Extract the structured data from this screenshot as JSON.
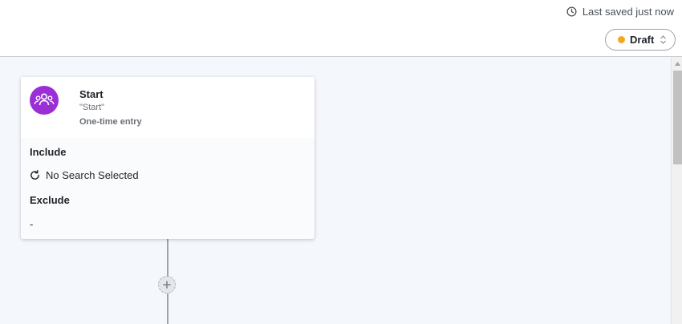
{
  "header": {
    "last_saved": "Last saved just now",
    "last_saved_icon": "clock-icon",
    "status": {
      "label": "Draft",
      "dot_color": "#f5a623",
      "icon": "chevron-up-down-icon"
    }
  },
  "canvas": {
    "start_card": {
      "icon": "users-group-icon",
      "icon_color": "#9b2fd6",
      "title": "Start",
      "subtitle": "\"Start\"",
      "entry_type": "One-time entry",
      "include": {
        "label": "Include",
        "value": "No Search Selected",
        "icon": "refresh-icon"
      },
      "exclude": {
        "label": "Exclude",
        "value": "-"
      }
    },
    "add_step_icon": "plus-icon"
  }
}
